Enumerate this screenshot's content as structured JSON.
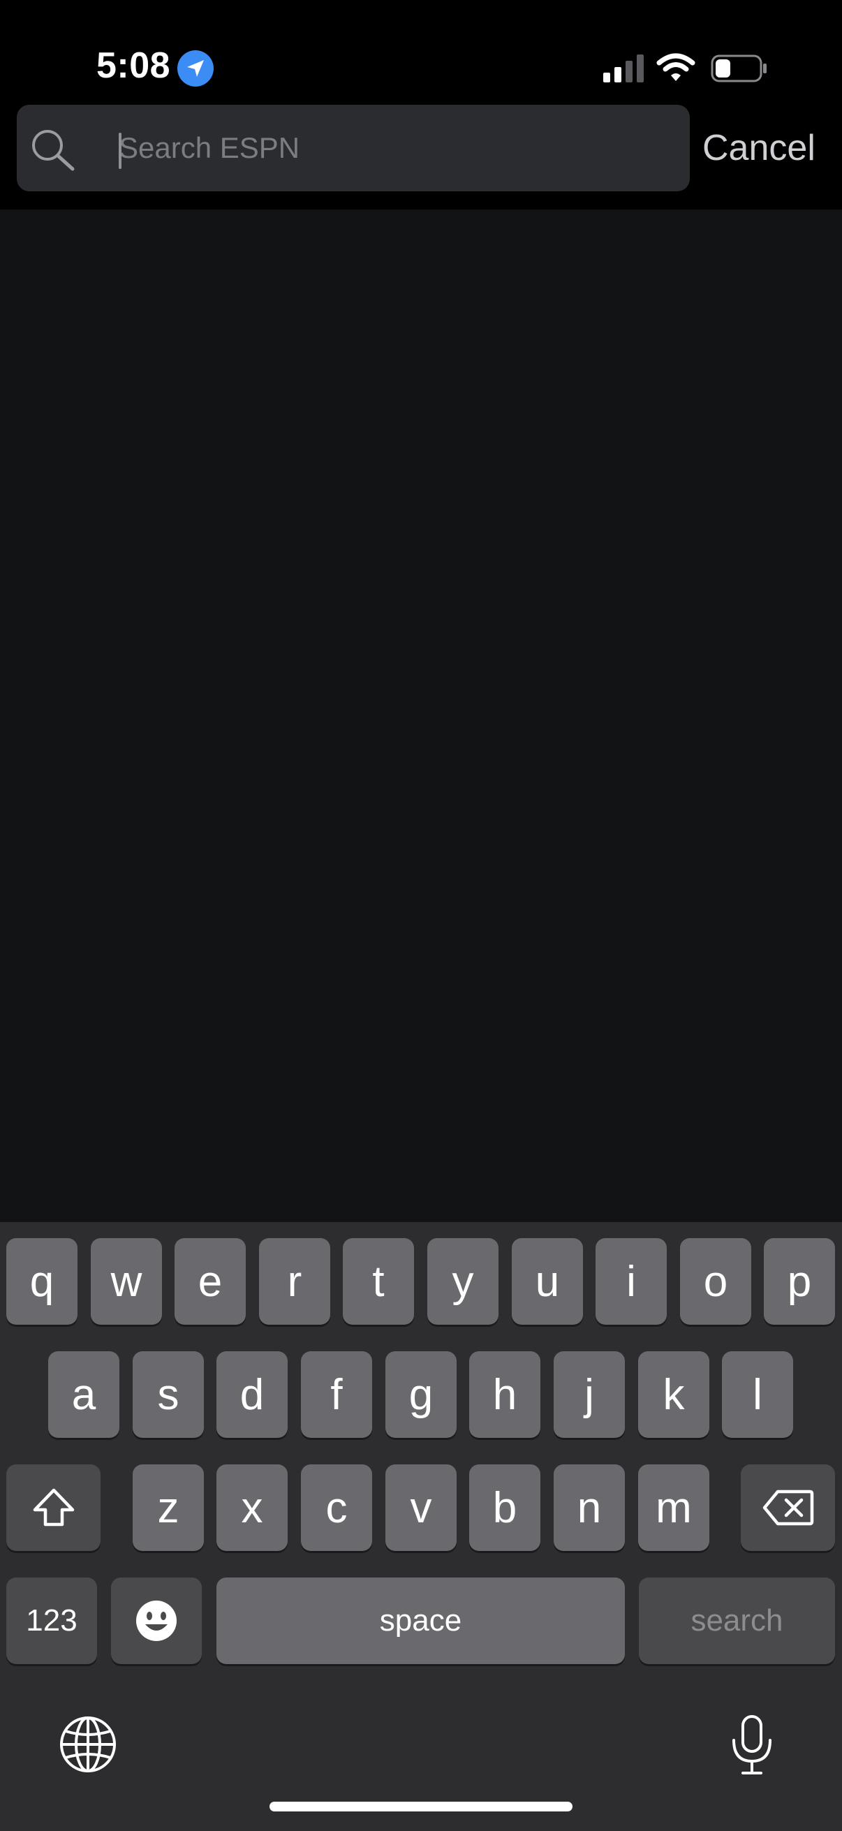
{
  "status_bar": {
    "time": "5:08",
    "location_icon": "location-arrow-icon",
    "signal_icon": "cellular-signal-icon",
    "wifi_icon": "wifi-icon",
    "battery_icon": "battery-icon",
    "battery_level": 0.35
  },
  "search": {
    "placeholder": "Search ESPN",
    "value": "",
    "icon": "search-icon",
    "cancel_label": "Cancel"
  },
  "keyboard": {
    "row1": [
      "q",
      "w",
      "e",
      "r",
      "t",
      "y",
      "u",
      "i",
      "o",
      "p"
    ],
    "row2": [
      "a",
      "s",
      "d",
      "f",
      "g",
      "h",
      "j",
      "k",
      "l"
    ],
    "row3": [
      "z",
      "x",
      "c",
      "v",
      "b",
      "n",
      "m"
    ],
    "numbers_label": "123",
    "space_label": "space",
    "search_label": "search",
    "icons": {
      "shift": "shift-icon",
      "delete": "delete-icon",
      "emoji": "emoji-icon",
      "globe": "globe-icon",
      "microphone": "microphone-icon"
    }
  },
  "colors": {
    "background": "#121315",
    "header": "#000000",
    "search_field": "#2b2c2f",
    "location_badge": "#3c8cf5",
    "keyboard": "#2d2d2f",
    "key": "#6a6a6e",
    "key_dark": "#4a4a4d"
  }
}
